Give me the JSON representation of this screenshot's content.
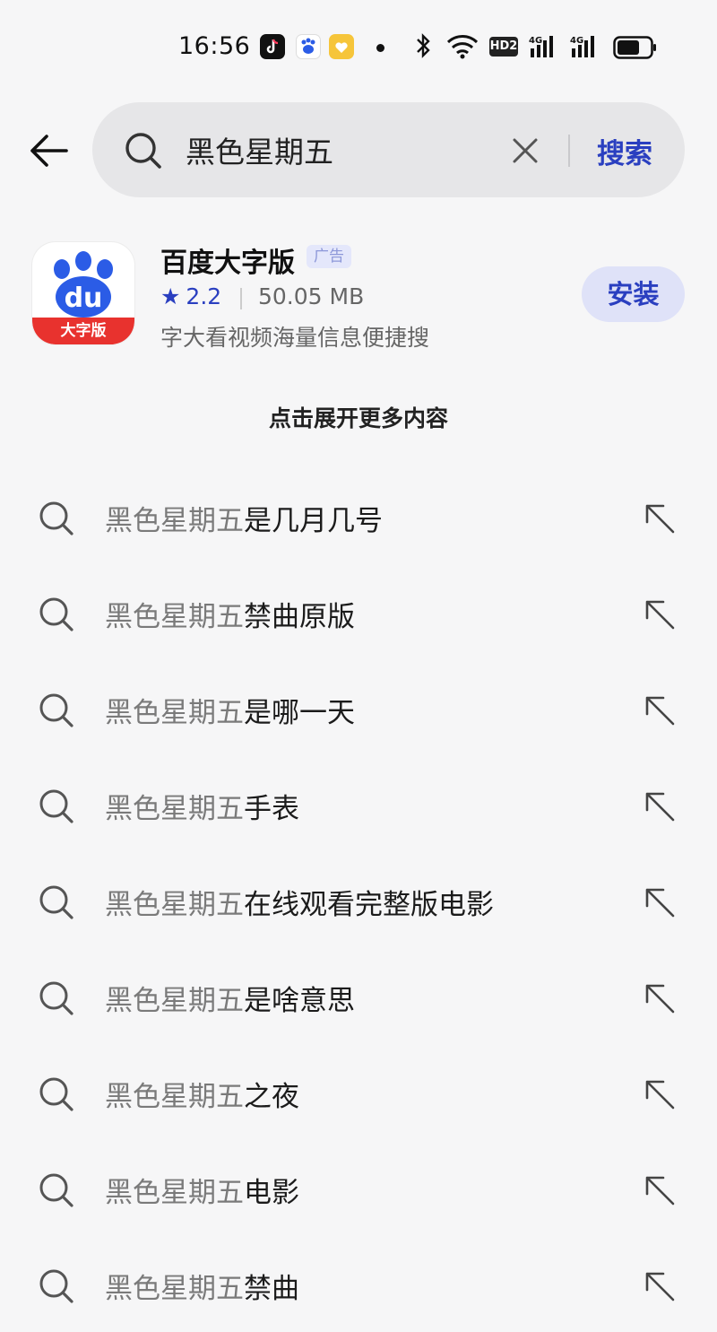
{
  "status_bar": {
    "time": "16:56",
    "hd_label": "HD2",
    "app_icons": [
      "tiktok-icon",
      "baidu-icon",
      "heart-app-icon"
    ],
    "indicators": [
      "bluetooth-icon",
      "wifi-icon",
      "hd-volte-icon",
      "signal-4g-icon",
      "signal-4g-icon",
      "battery-icon"
    ]
  },
  "search": {
    "query": "黑色星期五",
    "search_label": "搜索"
  },
  "ad": {
    "app_name": "百度大字版",
    "badge": "广告",
    "icon_ribbon": "大字版",
    "icon_logo": "du",
    "rating": "2.2",
    "size": "50.05 MB",
    "description": "字大看视频海量信息便捷搜",
    "install_label": "安装"
  },
  "expand_label": "点击展开更多内容",
  "suggestions": [
    {
      "prefix": "黑色星期五",
      "suffix": "是几月几号"
    },
    {
      "prefix": "黑色星期五",
      "suffix": "禁曲原版"
    },
    {
      "prefix": "黑色星期五",
      "suffix": "是哪一天"
    },
    {
      "prefix": "黑色星期五",
      "suffix": "手表"
    },
    {
      "prefix": "黑色星期五",
      "suffix": "在线观看完整版电影"
    },
    {
      "prefix": "黑色星期五",
      "suffix": "是啥意思"
    },
    {
      "prefix": "黑色星期五",
      "suffix": "之夜"
    },
    {
      "prefix": "黑色星期五",
      "suffix": "电影"
    },
    {
      "prefix": "黑色星期五",
      "suffix": "禁曲"
    }
  ],
  "colors": {
    "accent": "#2a3fc0",
    "background": "#f6f6f7",
    "search_box": "#e6e6e8",
    "baidu_red": "#e8322e",
    "baidu_blue": "#2b5ce6"
  }
}
